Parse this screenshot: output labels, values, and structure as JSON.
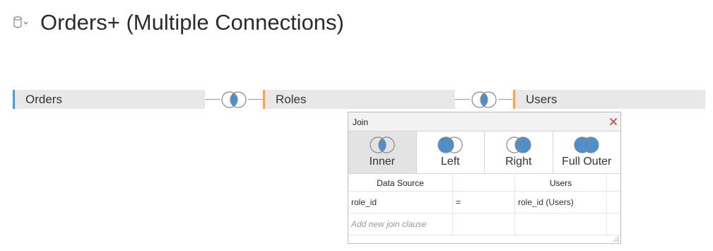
{
  "header": {
    "title": "Orders+ (Multiple Connections)",
    "icon": "database-icon"
  },
  "tables": [
    {
      "name": "Orders",
      "accent": "#4e9ad4"
    },
    {
      "name": "Roles",
      "accent": "#f0a65a"
    },
    {
      "name": "Users",
      "accent": "#f0a65a"
    }
  ],
  "joins": [
    {
      "type": "inner",
      "icon": "inner-join-icon"
    },
    {
      "type": "inner",
      "icon": "inner-join-icon"
    }
  ],
  "join_dialog": {
    "title": "Join",
    "close_icon": "close-icon",
    "join_types": [
      {
        "label": "Inner",
        "selected": true,
        "icon": "inner-join-icon"
      },
      {
        "label": "Left",
        "selected": false,
        "icon": "left-join-icon"
      },
      {
        "label": "Right",
        "selected": false,
        "icon": "right-join-icon"
      },
      {
        "label": "Full Outer",
        "selected": false,
        "icon": "full-outer-join-icon"
      }
    ],
    "columns": [
      "Data Source",
      "",
      "Users"
    ],
    "clauses": [
      {
        "left": "role_id",
        "operator": "=",
        "right": "role_id (Users)"
      }
    ],
    "add_clause_placeholder": "Add new join clause"
  },
  "colors": {
    "join_fill": "#4a90d0",
    "close_red": "#c8493a",
    "pill_bg": "#e8e8e8"
  }
}
